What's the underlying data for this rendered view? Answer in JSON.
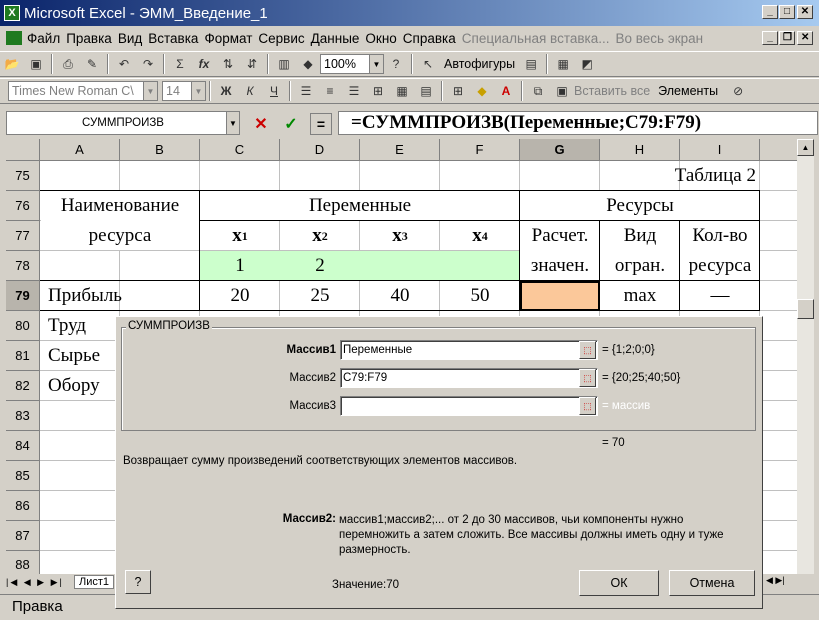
{
  "window": {
    "title": "Microsoft Excel - ЭММ_Введение_1",
    "icon_text": "X"
  },
  "menu": {
    "items": [
      "Файл",
      "Правка",
      "Вид",
      "Вставка",
      "Формат",
      "Сервис",
      "Данные",
      "Окно",
      "Справка"
    ],
    "disabled": [
      "Специальная вставка...",
      "Во весь экран"
    ]
  },
  "toolbar1": {
    "zoom": "100%",
    "autoshapes": "Автофигуры"
  },
  "toolbar2": {
    "font": "Times New Roman C\\",
    "size": "14",
    "bold": "Ж",
    "italic": "К",
    "underline": "Ч",
    "paste_all": "Вставить все",
    "elements": "Элементы"
  },
  "formula_bar": {
    "name_box": "СУММПРОИЗВ",
    "cancel": "✕",
    "enter": "✓",
    "equals": "=",
    "formula": "=СУММПРОИЗВ(Переменные;C79:F79)"
  },
  "columns": [
    "A",
    "B",
    "C",
    "D",
    "E",
    "F",
    "G",
    "H",
    "I"
  ],
  "rows": [
    "75",
    "76",
    "77",
    "78",
    "79",
    "80",
    "81",
    "82",
    "83",
    "84",
    "85",
    "86",
    "87",
    "88"
  ],
  "sheet": {
    "table_caption": "Таблица 2",
    "hdr_name_1": "Наименование",
    "hdr_name_2": "ресурса",
    "hdr_variables": "Переменные",
    "hdr_resources": "Ресурсы",
    "x1": "x",
    "x2": "x",
    "x3": "x",
    "x4": "x",
    "sub1": "1",
    "sub2": "2",
    "sub3": "3",
    "sub4": "4",
    "calc_1": "Расчет.",
    "calc_2": "значен.",
    "kind_1": "Вид",
    "kind_2": "огран.",
    "qty_1": "Кол-во",
    "qty_2": "ресурса",
    "var_values": [
      "1",
      "2",
      "",
      ""
    ],
    "r79_label": "Прибыль",
    "r79_values": [
      "20",
      "25",
      "40",
      "50"
    ],
    "r79_kind": "max",
    "r79_qty": "—",
    "r80_label": "Труд",
    "r81_label": "Сырье",
    "r82_label": "Обору"
  },
  "sheet_tab": "Лист1",
  "status": "Правка",
  "dialog": {
    "title": "СУММПРОИЗВ",
    "arg1_label": "Массив1",
    "arg1_value": "Переменные",
    "arg1_result": "= {1;2;0;0}",
    "arg2_label": "Массив2",
    "arg2_value": "C79:F79",
    "arg2_result": "= {20;25;40;50}",
    "arg3_label": "Массив3",
    "arg3_value": "",
    "arg3_result": "= массив",
    "total": "= 70",
    "description": "Возвращает сумму произведений соответствующих элементов массивов.",
    "help_label": "Массив2:",
    "help_text": "массив1;массив2;... от 2 до 30 массивов, чьи компоненты нужно перемножить а затем сложить. Все массивы должны иметь одну и туже размерность.",
    "value_text": "Значение:70",
    "ok": "ОК",
    "cancel": "Отмена"
  }
}
